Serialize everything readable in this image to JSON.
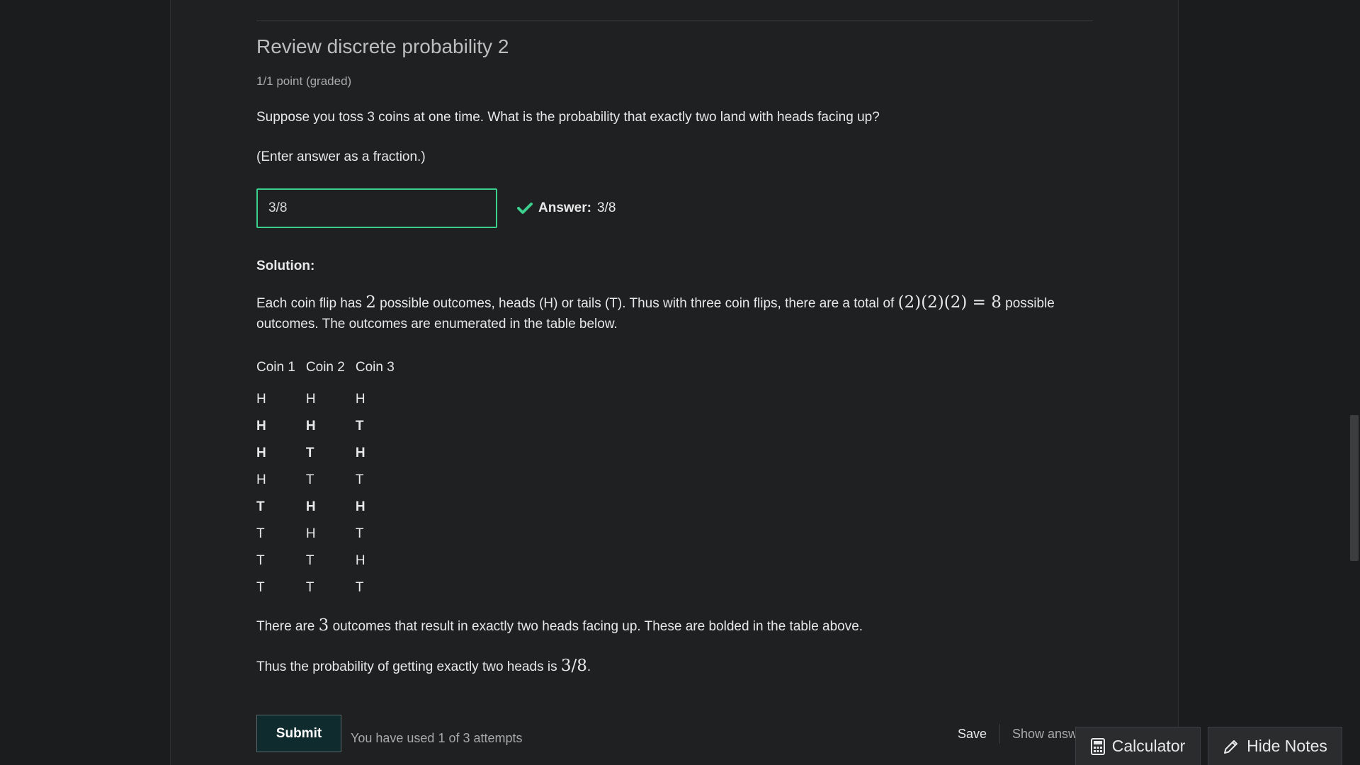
{
  "problem": {
    "title": "Review discrete probability 2",
    "points": "1/1 point (graded)",
    "question": "Suppose you toss 3 coins at one time. What is the probability that exactly two land with heads facing up?",
    "instruction": "(Enter answer as a fraction.)",
    "input_value": "3/8",
    "answer_label": "Answer:",
    "answer_value": "3/8",
    "status_color": "#3ccf8e"
  },
  "solution": {
    "heading": "Solution:",
    "p1_a": "Each coin flip has ",
    "p1_m1": "2",
    "p1_b": " possible outcomes, heads (H) or tails (T). Thus with three coin flips, there are a total of ",
    "p1_m2": "(2)(2)(2) = 8",
    "p1_c": " possible outcomes. The outcomes are enumerated in the table below.",
    "table": {
      "headers": [
        "Coin 1",
        "Coin 2",
        "Coin 3"
      ],
      "rows": [
        [
          "H",
          "H",
          "H"
        ],
        [
          "H",
          "H",
          "T"
        ],
        [
          "H",
          "T",
          "H"
        ],
        [
          "H",
          "T",
          "T"
        ],
        [
          "T",
          "H",
          "H"
        ],
        [
          "T",
          "H",
          "T"
        ],
        [
          "T",
          "T",
          "H"
        ],
        [
          "T",
          "T",
          "T"
        ]
      ],
      "bold_rows": [
        1,
        2,
        4
      ]
    },
    "p2_a": "There are ",
    "p2_m": "3",
    "p2_b": " outcomes that result in exactly two heads facing up. These are bolded in the table above.",
    "p3_a": "Thus the probability of getting exactly two heads is ",
    "p3_m": "3/8",
    "p3_b": "."
  },
  "actions": {
    "submit_label": "Submit",
    "attempts_text": "You have used 1 of 3 attempts",
    "save_label": "Save",
    "show_answer_label": "Show answer"
  },
  "tools": {
    "calculator_label": "Calculator",
    "calculator_icon": "calculator-icon",
    "notes_label": "Hide Notes",
    "notes_icon": "pencil-icon"
  }
}
